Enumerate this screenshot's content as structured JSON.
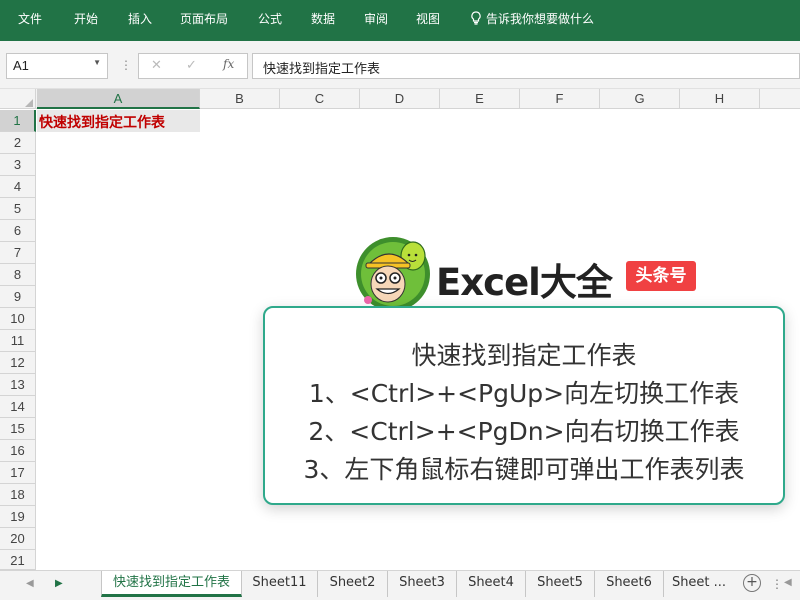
{
  "ribbon": {
    "tabs": [
      "文件",
      "开始",
      "插入",
      "页面布局",
      "公式",
      "数据",
      "审阅",
      "视图"
    ],
    "search_text": "告诉我你想要做什么"
  },
  "formula_bar": {
    "name_box": "A1",
    "separator": "⋮",
    "cancel_icon": "✕",
    "enter_icon": "✓",
    "fx_label": "fx",
    "content": "快速找到指定工作表"
  },
  "columns": [
    "A",
    "B",
    "C",
    "D",
    "E",
    "F",
    "G",
    "H"
  ],
  "rows": [
    "1",
    "2",
    "3",
    "4",
    "5",
    "6",
    "7",
    "8",
    "9",
    "10",
    "11",
    "12",
    "13",
    "14",
    "15",
    "16",
    "17",
    "18",
    "19",
    "20",
    "21"
  ],
  "cell_a1": "快速找到指定工作表",
  "cell_a1_color": "#c00000",
  "brand": {
    "title": "Excel大全",
    "tag": "头条号",
    "tag_color": "#f04142"
  },
  "info_box": {
    "border_color": "#2fa98b",
    "lines": [
      "快速找到指定工作表",
      "1、<Ctrl>+<PgUp>向左切换工作表",
      "2、<Ctrl>+<PgDn>向右切换工作表",
      "3、左下角鼠标右键即可弹出工作表列表"
    ]
  },
  "sheet_tabs": {
    "nav_left": "◀",
    "nav_right": "▶",
    "tabs": [
      "快速找到指定工作表",
      "Sheet11",
      "Sheet2",
      "Sheet3",
      "Sheet4",
      "Sheet5",
      "Sheet6",
      "Sheet ..."
    ],
    "add": "+",
    "more": "⋮"
  },
  "theme": {
    "accent": "#217346"
  }
}
